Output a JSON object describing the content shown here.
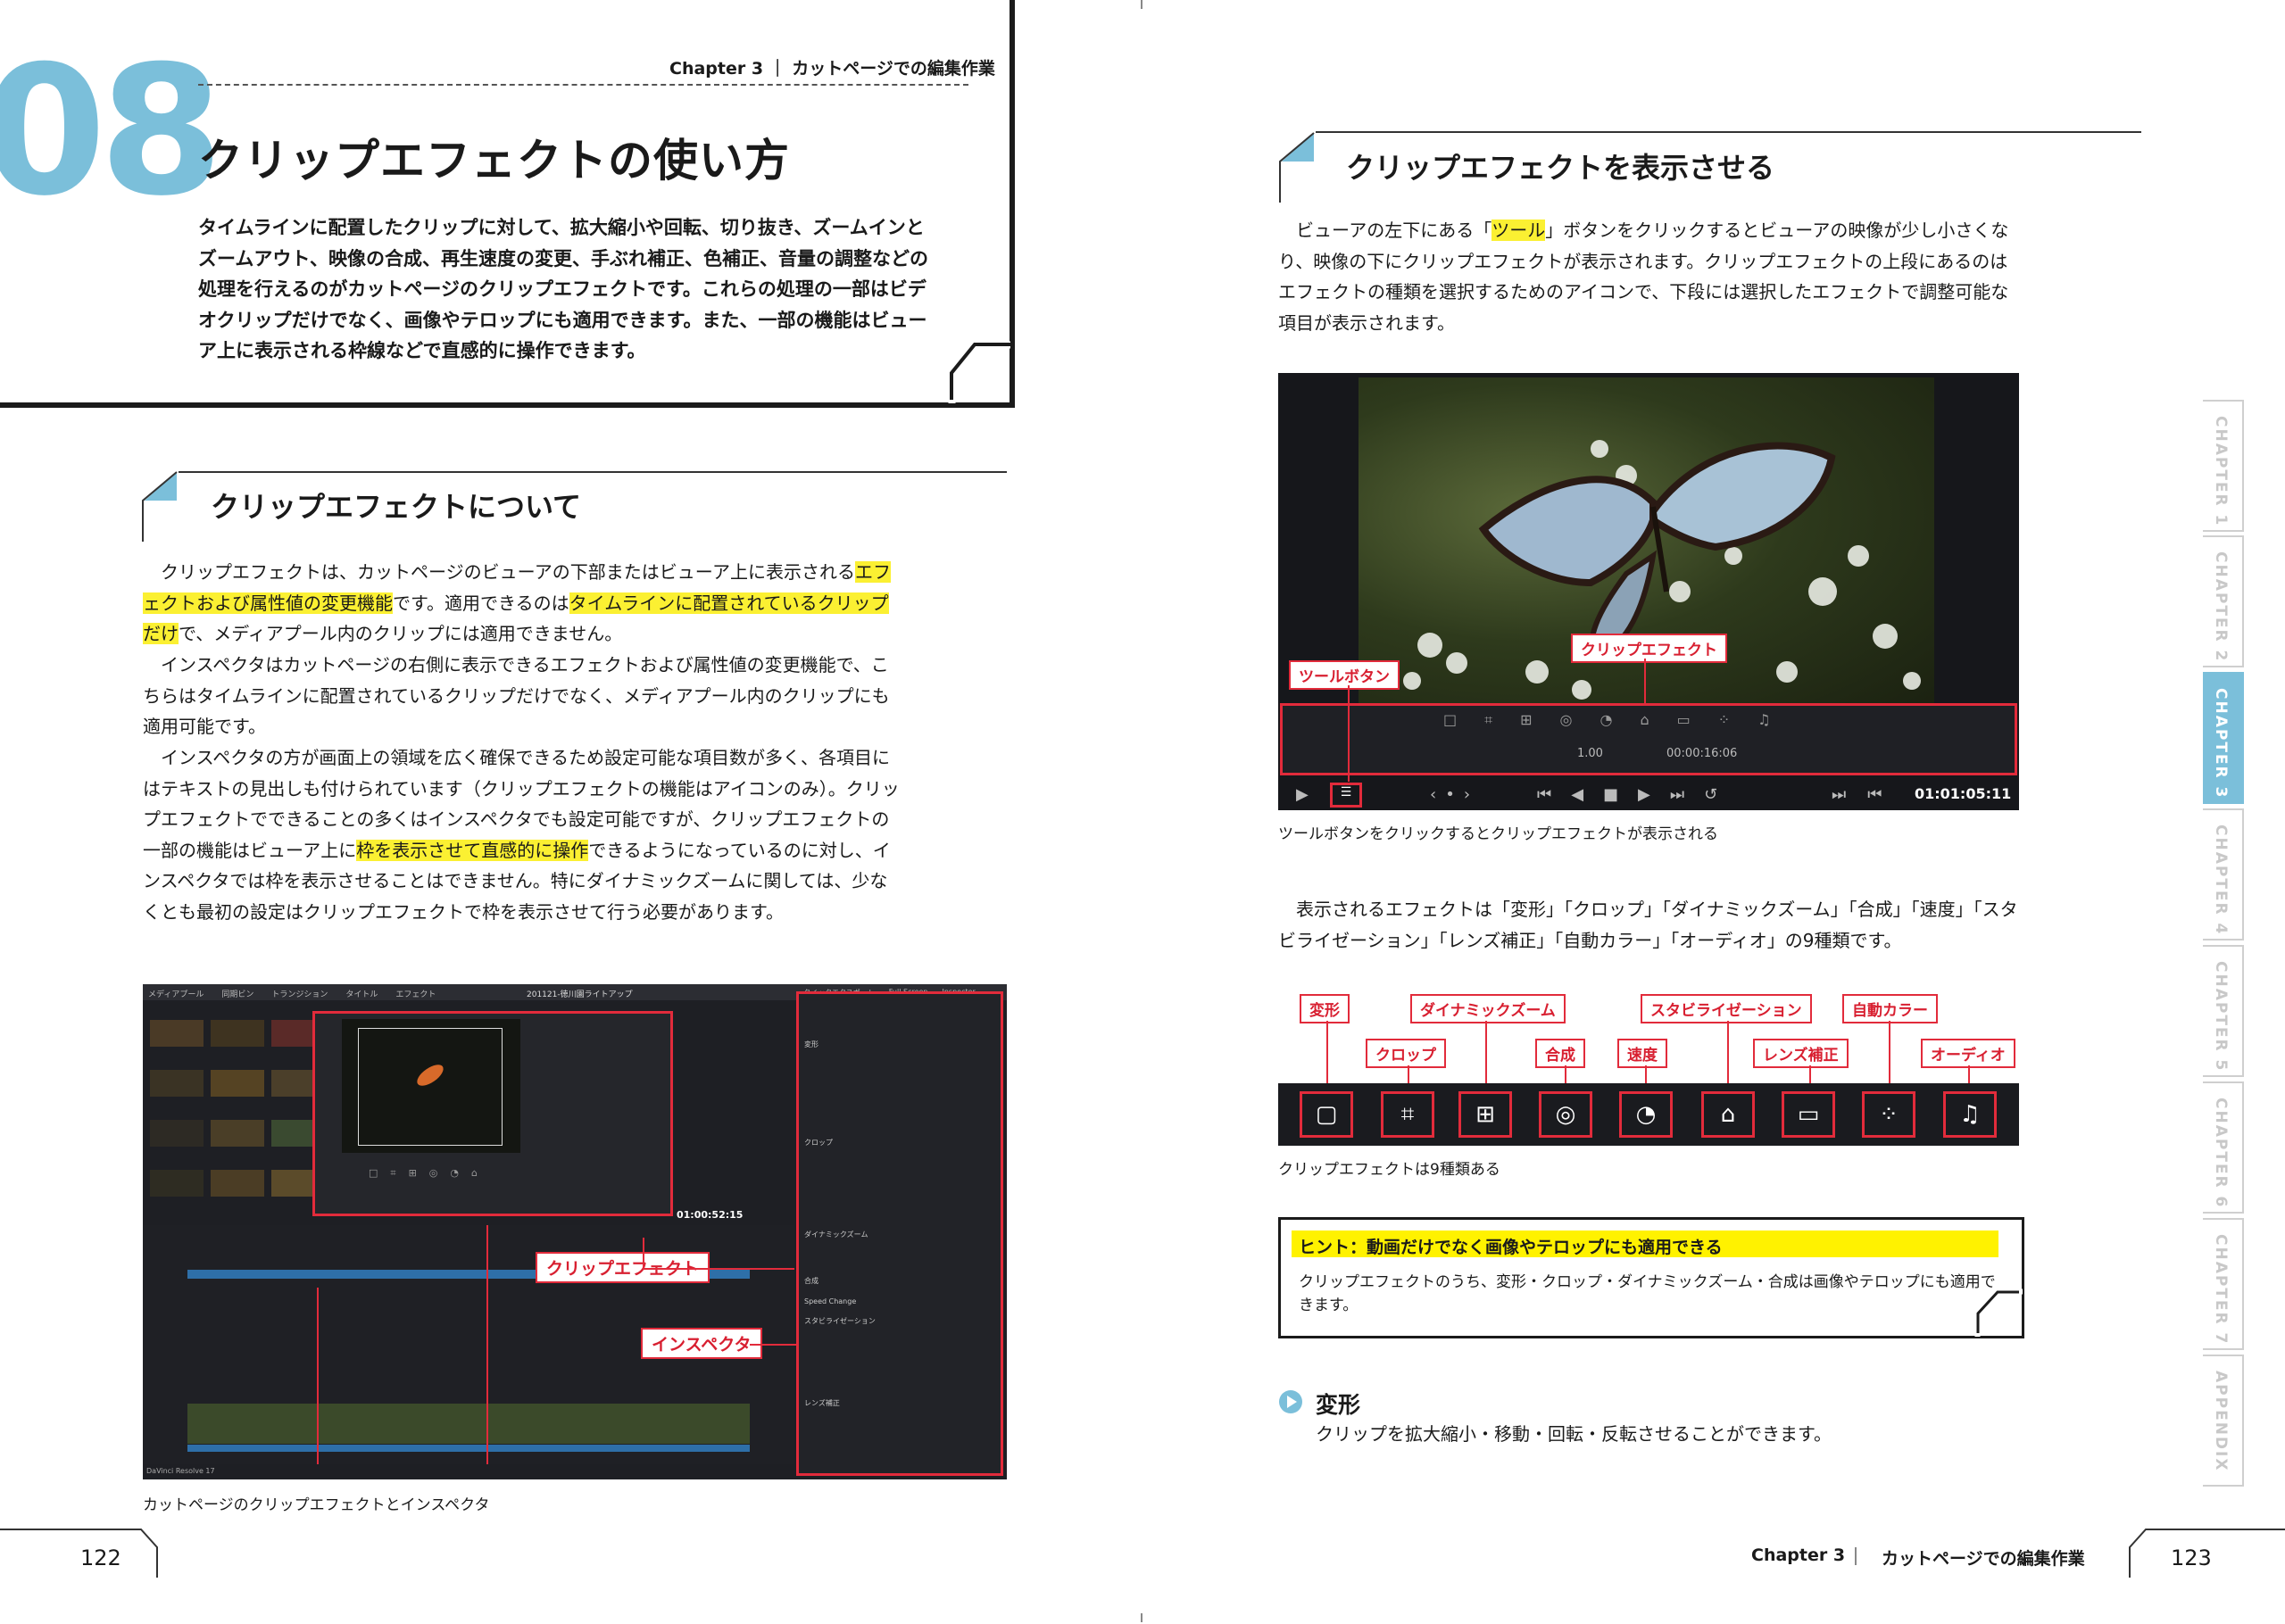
{
  "left_page": {
    "chapter_number": "08",
    "header_chapter": "Chapter 3 ｜ カットページでの編集作業",
    "chapter_title": "クリップエフェクトの使い方",
    "lead": "タイムラインに配置したクリップに対して、拡大縮小や回転、切り抜き、ズームインとズームアウト、映像の合成、再生速度の変更、手ぶれ補正、色補正、音量の調整などの処理を行えるのがカットページのクリップエフェクトです。これらの処理の一部はビデオクリップだけでなく、画像やテロップにも適用できます。また、一部の機能はビューア上に表示される枠線などで直感的に操作できます。",
    "section_title": "クリップエフェクトについて",
    "p1_a": "　クリップエフェクトは、カットページのビューアの下部またはビューア上に表示される",
    "p1_hl1": "エフェクトおよび属性値の変更機能",
    "p1_b": "です。適用できるのは",
    "p1_hl2": "タイムラインに配置されている",
    "p1_hl3": "クリップだけ",
    "p1_c": "で、メディアプール内のクリップには適用できません。",
    "p2": "　インスペクタはカットページの右側に表示できるエフェクトおよび属性値の変更機能で、こちらはタイムラインに配置されているクリップだけでなく、メディアプール内のクリップにも適用可能です。",
    "p3_a": "　インスペクタの方が画面上の領域を広く確保できるため設定可能な項目数が多く、各項目にはテキストの見出しも付けられています（クリップエフェクトの機能はアイコンのみ）。クリップエフェクトでできることの多くはインスペクタでも設定可能ですが、クリップエフェクトの一部の機能はビューア上に",
    "p3_hl": "枠を表示させて直感的に操作",
    "p3_b": "できるようになっているのに対し、インスペクタでは枠を表示させることはできません。特にダイナミックズームに関しては、少なくとも最初の設定はクリップエフェクトで枠を表示させて行う必要があります。",
    "shot1": {
      "callout_clip": "クリップエフェクト",
      "callout_inspector": "インスペクタ",
      "tabs": [
        "メディアプール",
        "同期ビン",
        "トランジション",
        "タイトル",
        "エフェクト"
      ],
      "project_title": "201121-徳川園ライトアップ",
      "right_tabs": [
        "クイックエクスポート",
        "Full Screen",
        "Inspector"
      ],
      "timeline_name": "Timeline 1",
      "timecode": "01:00:52:15",
      "inspector_sections": [
        "変形",
        "クロップ",
        "ダイナミックズーム",
        "合成",
        "Speed Change",
        "スタビライゼーション",
        "レンズ補正"
      ],
      "brand": "DaVinci Resolve 17"
    },
    "caption1": "カットページのクリップエフェクトとインスペクタ",
    "page_number": "122"
  },
  "right_page": {
    "section_title": "クリップエフェクトを表示させる",
    "p1_a": "　ビューアの左下にある「",
    "p1_hl": "ツール",
    "p1_b": "」ボタンをクリックするとビューアの映像が少し小さくなり、映像の下にクリップエフェクトが表示されます。クリップエフェクトの上段にあるのはエフェクトの種類を選択するためのアイコンで、下段には選択したエフェクトで調整可能な項目が表示されます。",
    "shot2": {
      "callout_tool": "ツールボタン",
      "callout_clip": "クリップエフェクト",
      "value_speed": "1.00",
      "value_duration": "00:00:16:06",
      "timecode": "01:01:05:11"
    },
    "caption2": "ツールボタンをクリックするとクリップエフェクトが表示される",
    "p2": "　表示されるエフェクトは「変形」「クロップ」「ダイナミックズーム」「合成」「速度」「スタビライゼーション」「レンズ補正」「自動カラー」「オーディオ」の9種類です。",
    "effects_top": [
      "変形",
      "ダイナミックズーム",
      "スタビライゼーション",
      "自動カラー"
    ],
    "effects_bottom": [
      "クロップ",
      "合成",
      "速度",
      "レンズ補正",
      "オーディオ"
    ],
    "caption3": "クリップエフェクトは9種類ある",
    "hint_title": "ヒント：動画だけでなく画像やテロップにも適用できる",
    "hint_body": "クリップエフェクトのうち、変形・クロップ・ダイナミックズーム・合成は画像やテロップにも適用できます。",
    "subhead": "変形",
    "subhead_body": "クリップを拡大縮小・移動・回転・反転させることができます。",
    "footer_chapter": "Chapter 3",
    "footer_title": "カットページでの編集作業",
    "page_number": "123"
  },
  "side_tabs": [
    {
      "label": "CHAPTER 1",
      "active": false
    },
    {
      "label": "CHAPTER 2",
      "active": false
    },
    {
      "label": "CHAPTER 3",
      "active": true
    },
    {
      "label": "CHAPTER 4",
      "active": false
    },
    {
      "label": "CHAPTER 5",
      "active": false
    },
    {
      "label": "CHAPTER 6",
      "active": false
    },
    {
      "label": "CHAPTER 7",
      "active": false
    },
    {
      "label": "APPENDIX",
      "active": false
    }
  ],
  "colors": {
    "accent": "#7bbfda",
    "highlight": "#fbf032",
    "callout_red": "#e22b3b",
    "hint_yellow": "#fff200"
  }
}
